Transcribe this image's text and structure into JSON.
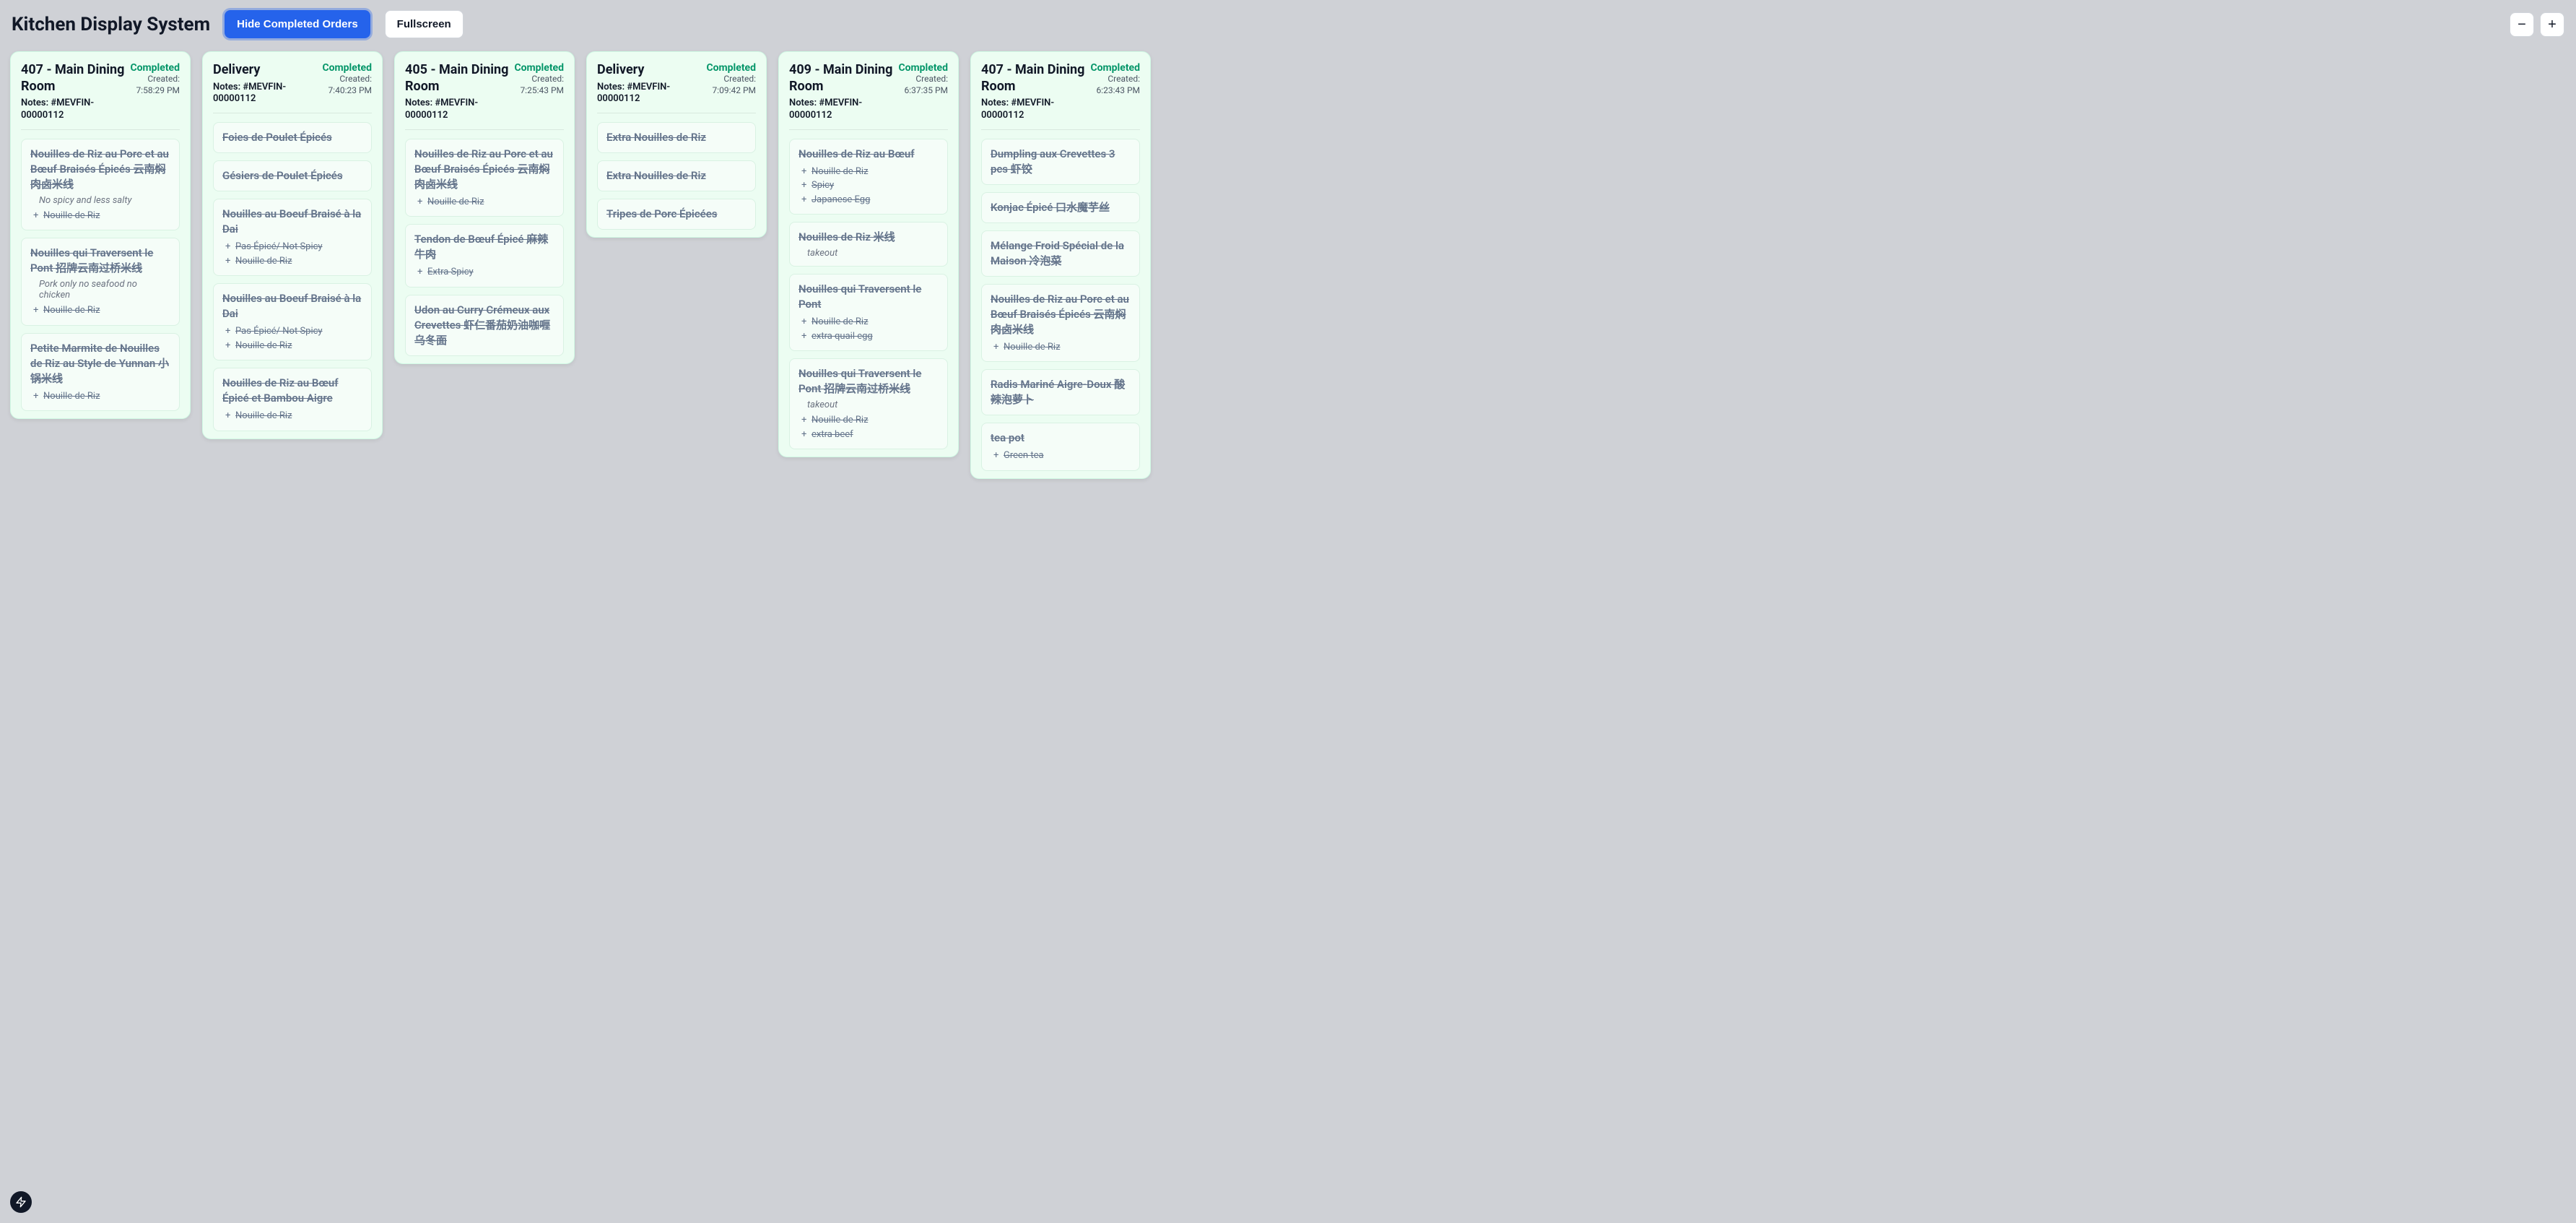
{
  "header": {
    "title": "Kitchen Display System",
    "hide_completed_label": "Hide Completed Orders",
    "fullscreen_label": "Fullscreen",
    "zoom_out_glyph": "−",
    "zoom_in_glyph": "+"
  },
  "status_label": "Completed",
  "created_label": "Created:",
  "orders": [
    {
      "title": "407 - Main Dining Room",
      "notes": "Notes: #MEVFIN-00000112",
      "time": "7:58:29 PM",
      "items": [
        {
          "name": "Nouilles de Riz au Porc et au Bœuf Braisés Épicés 云南焖肉卤米线",
          "note": "No spicy and less salty",
          "mods": [
            "Nouille de Riz"
          ]
        },
        {
          "name": "Nouilles qui Traversent le Pont 招牌云南过桥米线",
          "note": "Pork only no seafood no chicken",
          "mods": [
            "Nouille de Riz"
          ]
        },
        {
          "name": "Petite Marmite de Nouilles de Riz au Style de Yunnan 小锅米线",
          "mods": [
            "Nouille de Riz"
          ]
        }
      ]
    },
    {
      "title": "Delivery",
      "notes": "Notes: #MEVFIN-00000112",
      "time": "7:40:23 PM",
      "items": [
        {
          "name": "Foies de Poulet Épicés"
        },
        {
          "name": "Gésiers de Poulet Épicés"
        },
        {
          "name": "Nouilles au Boeuf Braisé à la Dai",
          "mods": [
            "Pas Épicé/ Not Spicy",
            "Nouille de Riz"
          ]
        },
        {
          "name": "Nouilles au Boeuf Braisé à la Dai",
          "mods": [
            "Pas Épicé/ Not Spicy",
            "Nouille de Riz"
          ]
        },
        {
          "name": "Nouilles de Riz au Bœuf Épicé et Bambou Aigre",
          "mods": [
            "Nouille de Riz"
          ]
        }
      ]
    },
    {
      "title": "405 - Main Dining Room",
      "notes": "Notes: #MEVFIN-00000112",
      "time": "7:25:43 PM",
      "items": [
        {
          "name": "Nouilles de Riz au Porc et au Bœuf Braisés Épicés 云南焖肉卤米线",
          "mods": [
            "Nouille de Riz"
          ]
        },
        {
          "name": "Tendon de Bœuf Épicé 麻辣牛肉",
          "mods": [
            "Extra Spicy"
          ]
        },
        {
          "name": "Udon au Curry Crémeux aux Crevettes 虾仁番茄奶油咖喱乌冬面"
        }
      ]
    },
    {
      "title": "Delivery",
      "notes": "Notes: #MEVFIN-00000112",
      "time": "7:09:42 PM",
      "items": [
        {
          "name": "Extra Nouilles de Riz"
        },
        {
          "name": "Extra Nouilles de Riz"
        },
        {
          "name": "Tripes de Porc Épicées"
        }
      ]
    },
    {
      "title": "409 - Main Dining Room",
      "notes": "Notes: #MEVFIN-00000112",
      "time": "6:37:35 PM",
      "items": [
        {
          "name": "Nouilles de Riz au Bœuf",
          "mods": [
            "Nouille de Riz",
            "Spicy",
            "Japanese Egg"
          ]
        },
        {
          "name": "Nouilles de Riz 米线",
          "note": "takeout"
        },
        {
          "name": "Nouilles qui Traversent le Pont",
          "mods": [
            "Nouille de Riz",
            "extra quail egg"
          ]
        },
        {
          "name": "Nouilles qui Traversent le Pont 招牌云南过桥米线",
          "note": "takeout",
          "mods": [
            "Nouille de Riz",
            "extra beef"
          ]
        }
      ]
    },
    {
      "title": "407 - Main Dining Room",
      "notes": "Notes: #MEVFIN-00000112",
      "time": "6:23:43 PM",
      "items": [
        {
          "name": "Dumpling aux Crevettes 3 pcs 虾饺"
        },
        {
          "name": "Konjac Épicé 口水魔芋丝"
        },
        {
          "name": "Mélange Froid Spécial de la Maison 冷泡菜"
        },
        {
          "name": "Nouilles de Riz au Porc et au Bœuf Braisés Épicés 云南焖肉卤米线",
          "mods": [
            "Nouille de Riz"
          ]
        },
        {
          "name": "Radis Mariné Aigre-Doux 酸辣泡萝卜"
        },
        {
          "name": "tea pot",
          "mods": [
            "Green tea"
          ]
        }
      ]
    }
  ]
}
